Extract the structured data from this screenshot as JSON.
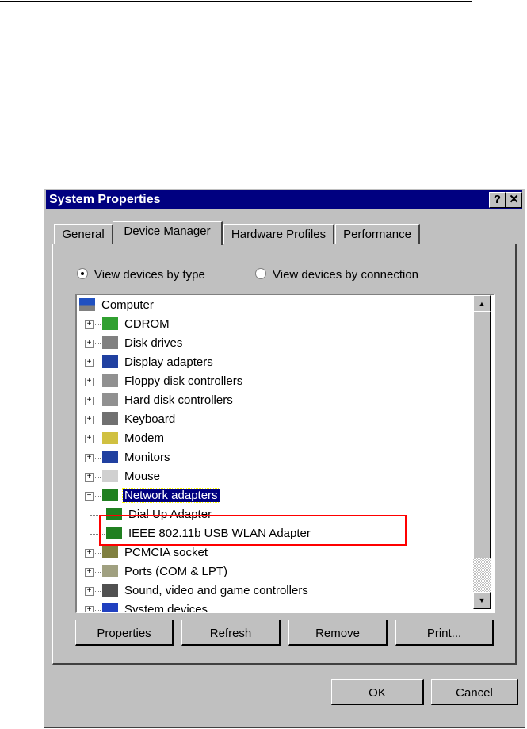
{
  "dialog": {
    "title": "System Properties",
    "help_button": "?",
    "close_button": "✕"
  },
  "tabs": [
    {
      "label": "General"
    },
    {
      "label": "Device Manager",
      "active": true
    },
    {
      "label": "Hardware Profiles"
    },
    {
      "label": "Performance"
    }
  ],
  "view_options": [
    {
      "label": "View devices by type",
      "selected": true
    },
    {
      "label": "View devices by connection",
      "selected": false
    }
  ],
  "tree": {
    "root": "Computer",
    "items": [
      {
        "label": "CDROM",
        "icon": "cdrom-icon",
        "expanded": false
      },
      {
        "label": "Disk drives",
        "icon": "disk-drive-icon",
        "expanded": false
      },
      {
        "label": "Display adapters",
        "icon": "display-icon",
        "expanded": false
      },
      {
        "label": "Floppy disk controllers",
        "icon": "floppy-controller-icon",
        "expanded": false
      },
      {
        "label": "Hard disk controllers",
        "icon": "hdd-controller-icon",
        "expanded": false
      },
      {
        "label": "Keyboard",
        "icon": "keyboard-icon",
        "expanded": false
      },
      {
        "label": "Modem",
        "icon": "modem-icon",
        "expanded": false
      },
      {
        "label": "Monitors",
        "icon": "monitor-icon",
        "expanded": false
      },
      {
        "label": "Mouse",
        "icon": "mouse-icon",
        "expanded": false
      },
      {
        "label": "Network adapters",
        "icon": "network-adapter-icon",
        "expanded": true,
        "selected": true,
        "children": [
          {
            "label": "Dial Up Adapter"
          },
          {
            "label": "IEEE 802.11b USB WLAN Adapter",
            "highlighted": true
          }
        ]
      },
      {
        "label": "PCMCIA socket",
        "icon": "pcmcia-icon",
        "expanded": false
      },
      {
        "label": "Ports (COM & LPT)",
        "icon": "port-icon",
        "expanded": false
      },
      {
        "label": "Sound, video and game controllers",
        "icon": "sound-icon",
        "expanded": false
      },
      {
        "label": "System devices",
        "icon": "system-icon",
        "expanded": false
      }
    ]
  },
  "buttons": {
    "properties": "Properties",
    "refresh": "Refresh",
    "remove": "Remove",
    "print": "Print...",
    "ok": "OK",
    "cancel": "Cancel"
  },
  "colors": {
    "titlebar": "#000080",
    "face": "#c0c0c0",
    "highlight_box": "#ff0000"
  }
}
